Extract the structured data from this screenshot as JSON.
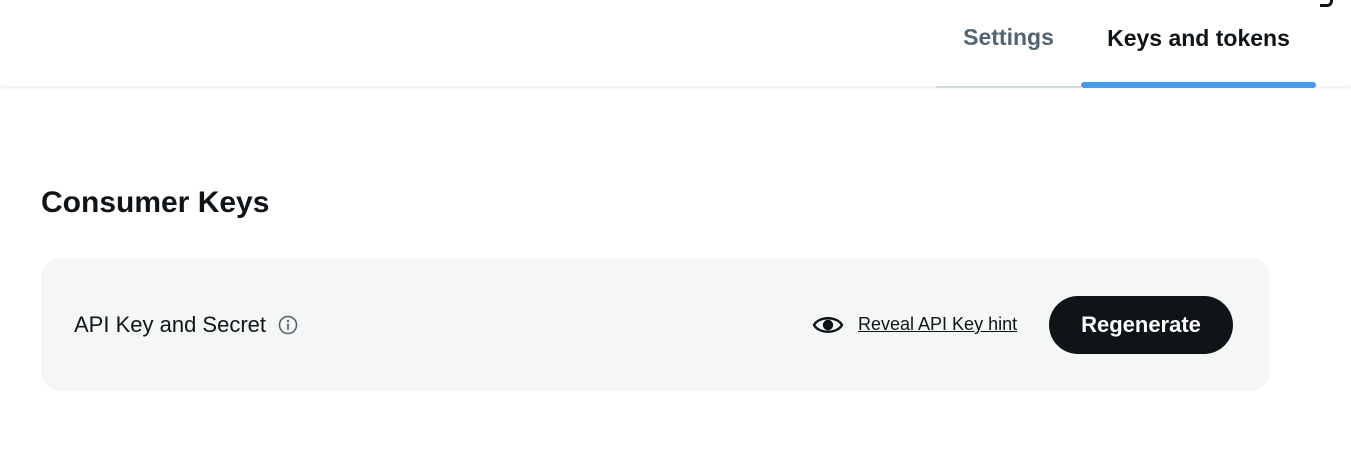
{
  "tabs": [
    {
      "label": "Settings",
      "active": false
    },
    {
      "label": "Keys and tokens",
      "active": true
    }
  ],
  "section": {
    "title": "Consumer Keys"
  },
  "api_card": {
    "label": "API Key and Secret",
    "info_icon": "info-icon",
    "reveal_icon": "eye-icon",
    "reveal_link": "Reveal API Key hint",
    "regenerate_label": "Regenerate"
  },
  "colors": {
    "active_tab_underline": "#4a99e9",
    "button_bg": "#0f1419",
    "card_bg": "#f5f6f6",
    "inactive_tab_text": "#536471"
  }
}
